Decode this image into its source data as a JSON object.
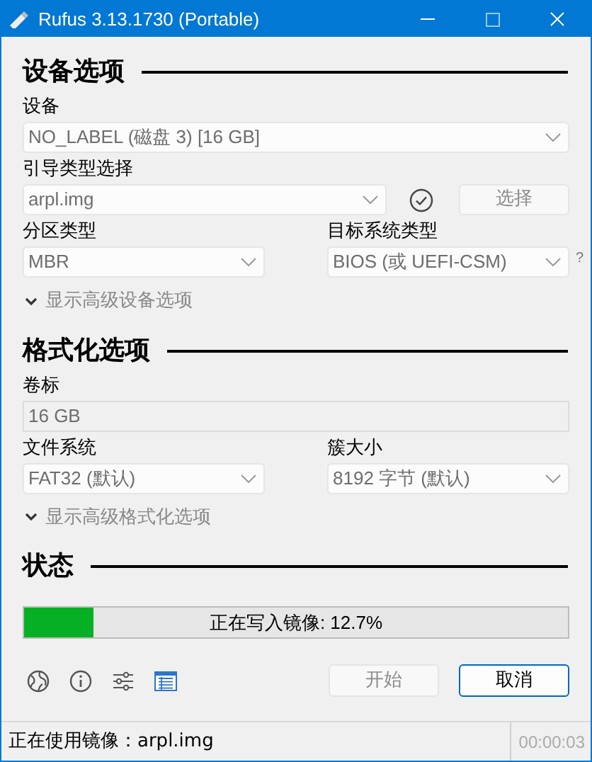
{
  "window": {
    "title": "Rufus 3.13.1730 (Portable)"
  },
  "sections": [
    {
      "title": "设备选项",
      "rows": [
        [
          {
            "label": "设备",
            "value": "NO_LABEL (磁盘 3) [16 GB]",
            "kind": "dropdown",
            "disabled": true
          }
        ],
        [
          {
            "label": "引导类型选择",
            "value": "arpl.img",
            "kind": "dropdown",
            "disabled": true,
            "button": "选择"
          }
        ],
        [
          {
            "label": "分区类型",
            "value": "MBR",
            "kind": "dropdown",
            "disabled": true
          },
          {
            "label": "目标系统类型",
            "value": "BIOS (或 UEFI-CSM)",
            "kind": "dropdown",
            "disabled": true,
            "help": "?"
          }
        ]
      ],
      "advanced": "显示高级设备选项"
    },
    {
      "title": "格式化选项",
      "rows": [
        [
          {
            "label": "卷标",
            "value": "16 GB",
            "kind": "text",
            "disabled": true
          }
        ],
        [
          {
            "label": "文件系统",
            "value": "FAT32 (默认)",
            "kind": "dropdown",
            "disabled": true
          },
          {
            "label": "簇大小",
            "value": "8192 字节 (默认)",
            "kind": "dropdown",
            "disabled": true
          }
        ]
      ],
      "advanced": "显示高级格式化选项"
    },
    {
      "title": "状态"
    }
  ],
  "progress": {
    "text": "正在写入镜像: 12.7%",
    "level": 0.127
  },
  "buttons": [
    {
      "label": "开始",
      "disabled": true
    },
    {
      "label": "取消",
      "disabled": false
    }
  ],
  "status_bar": {
    "text": "正在使用镜像：arpl.img",
    "time": "00:00:03"
  }
}
